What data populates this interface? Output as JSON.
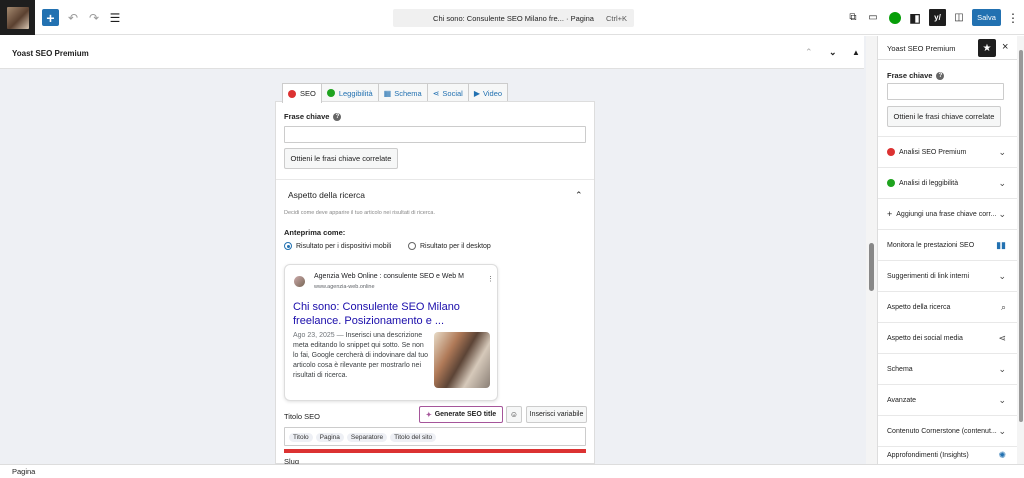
{
  "topbar": {
    "command_title": "Chi sono: Consulente SEO Milano fre... · Pagina",
    "command_shortcut": "Ctrl+K",
    "save_label": "Salva"
  },
  "metabox": {
    "title": "Yoast SEO Premium"
  },
  "yoast": {
    "tabs": [
      {
        "label": "SEO",
        "status_color": "#dc3232"
      },
      {
        "label": "Leggibilità",
        "status_color": "#1fa31f"
      },
      {
        "label": "Schema"
      },
      {
        "label": "Social"
      },
      {
        "label": "Video"
      }
    ],
    "keyphrase_label": "Frase chiave",
    "keyphrase_value": "",
    "related_button": "Ottieni le frasi chiave correlate",
    "search_appearance": {
      "title": "Aspetto della ricerca",
      "description": "Decidi come deve apparire il tuo articolo nei risultati di ricerca.",
      "preview_as_label": "Anteprima come:",
      "options": [
        "Risultato per i dispositivi mobili",
        "Risultato per il desktop"
      ],
      "selected": "Risultato per i dispositivi mobili"
    },
    "snippet": {
      "site_name": "Agenzia Web Online : consulente SEO e Web M",
      "site_url": "www.agenzia-web.online",
      "title": "Chi sono: Consulente SEO Milano freelance. Posizionamento e ...",
      "date": "Ago 23, 2025",
      "dash": " — ",
      "description": "Inserisci una descrizione meta editando lo snippet qui sotto. Se non lo fai, Google cercherà di indovinare dal tuo articolo cosa è rilevante per mostrarlo nei risultati di ricerca."
    },
    "seo_title_label": "Titolo SEO",
    "generate_button": "Generate SEO title",
    "insert_variable_button": "Inserisci variabile",
    "seo_title_chips": [
      "Titolo",
      "Pagina",
      "Separatore",
      "Titolo del sito"
    ],
    "slug_label": "Slug",
    "progress_color": "#dc3232"
  },
  "sidebar": {
    "title": "Yoast SEO Premium",
    "keyphrase_label": "Frase chiave",
    "keyphrase_value": "",
    "related_button": "Ottieni le frasi chiave correlate",
    "items": [
      {
        "label": "Analisi SEO Premium",
        "status_color": "#dc3232",
        "icon": "chevron-down-icon"
      },
      {
        "label": "Analisi di leggibilità",
        "status_color": "#1fa31f",
        "icon": "chevron-down-icon"
      },
      {
        "label": "Aggiungi una frase chiave corr...",
        "icon": "chevron-down-icon"
      },
      {
        "label": "Monitora le prestazioni SEO",
        "icon": "bar-chart-icon"
      },
      {
        "label": "Suggerimenti di link interni",
        "icon": "chevron-down-icon"
      },
      {
        "label": "Aspetto della ricerca",
        "icon": "search-icon"
      },
      {
        "label": "Aspetto dei social media",
        "icon": "share-icon"
      },
      {
        "label": "Schema",
        "icon": "chevron-down-icon"
      },
      {
        "label": "Avanzate",
        "icon": "chevron-down-icon"
      },
      {
        "label": "Contenuto Cornerstone (contenut...",
        "icon": "chevron-down-icon"
      },
      {
        "label": "Approfondimenti (Insights)",
        "icon": "sparkle-icon"
      }
    ]
  },
  "statusbar": {
    "text": "Pagina"
  },
  "colors": {
    "accent": "#2271b1",
    "link_blue": "#1a0dab",
    "error_red": "#dc3232",
    "success_green": "#1fa31f"
  }
}
